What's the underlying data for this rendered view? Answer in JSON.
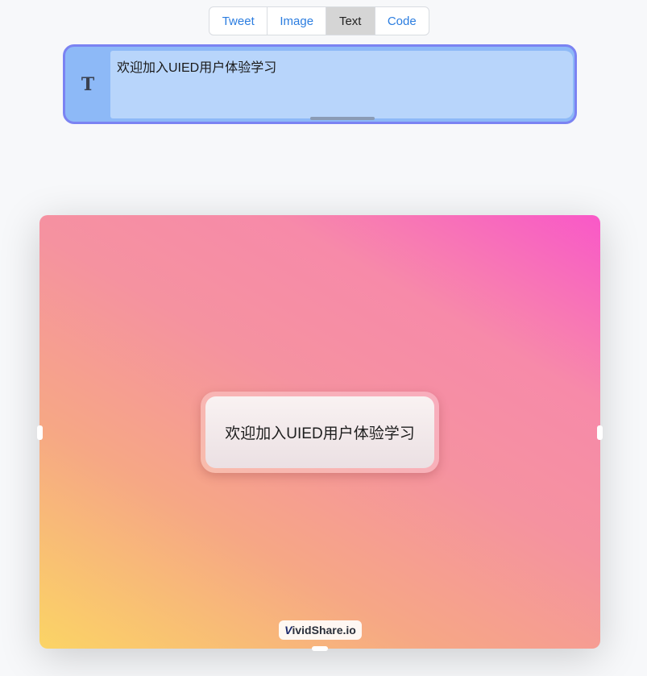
{
  "tabs": [
    {
      "label": "Tweet",
      "active": false
    },
    {
      "label": "Image",
      "active": false
    },
    {
      "label": "Text",
      "active": true
    },
    {
      "label": "Code",
      "active": false
    }
  ],
  "editor": {
    "icon_glyph": "T",
    "icon_name": "text-type-icon",
    "value": "欢迎加入UIED用户体验学习"
  },
  "preview": {
    "card_text": "欢迎加入UIED用户体验学习",
    "watermark_v": "V",
    "watermark_rest": "ividShare.io"
  },
  "colors": {
    "accent": "#2b7de0",
    "editor_border": "#7b83f2",
    "editor_bg": "#b8d5fb",
    "gradient_start": "#fbd465",
    "gradient_end": "#f958c8"
  }
}
